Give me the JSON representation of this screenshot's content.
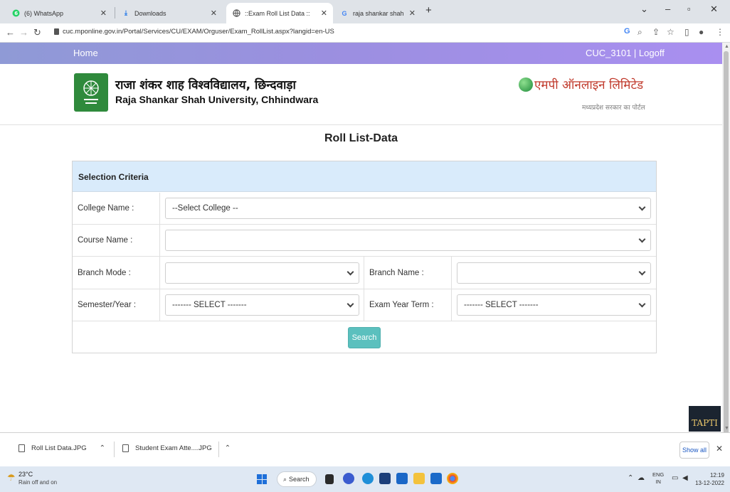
{
  "browser": {
    "tabs": [
      {
        "title": "(6) WhatsApp",
        "icon": "whatsapp-icon"
      },
      {
        "title": "Downloads",
        "icon": "download-icon"
      },
      {
        "title": "::Exam Roll List Data ::",
        "icon": "globe-icon"
      },
      {
        "title": "raja shankar shah university exa",
        "icon": "google-icon"
      }
    ],
    "new_tab": "+",
    "url": "cuc.mponline.gov.in/Portal/Services/CU/EXAM/Orguser/Exam_RollList.aspx?langid=en-US"
  },
  "nav": {
    "home": "Home",
    "user": "CUC_3101 | Logoff"
  },
  "header": {
    "university_hindi": "राजा शंकर शाह विश्वविद्यालय, छिन्दवाड़ा",
    "university_english": "Raja Shankar Shah University, Chhindwara",
    "partner_logo": "एमपी ऑनलाइन लिमिटेड",
    "partner_sub": "मध्यप्रदेश सरकार का पोर्टल"
  },
  "page": {
    "title": "Roll List-Data"
  },
  "form": {
    "heading": "Selection Criteria",
    "college_label": "College Name :",
    "college_value": "--Select College --",
    "course_label": "Course Name :",
    "course_value": "",
    "branch_mode_label": "Branch Mode :",
    "branch_mode_value": "",
    "branch_name_label": "Branch Name :",
    "branch_name_value": "",
    "semester_label": "Semester/Year :",
    "semester_value": "------- SELECT -------",
    "exam_term_label": "Exam Year Term :",
    "exam_term_value": "------- SELECT -------",
    "search_label": "Search"
  },
  "widget": {
    "tapti": "TAPTI"
  },
  "downloads": {
    "items": [
      {
        "name": "Roll List Data.JPG"
      },
      {
        "name": "Student Exam Atte....JPG"
      }
    ],
    "show_all": "Show all"
  },
  "taskbar": {
    "temperature": "23°C",
    "weather": "Rain off and on",
    "search": "Search",
    "lang_top": "ENG",
    "lang_bottom": "IN",
    "time": "12:19",
    "date": "13-12-2022"
  }
}
